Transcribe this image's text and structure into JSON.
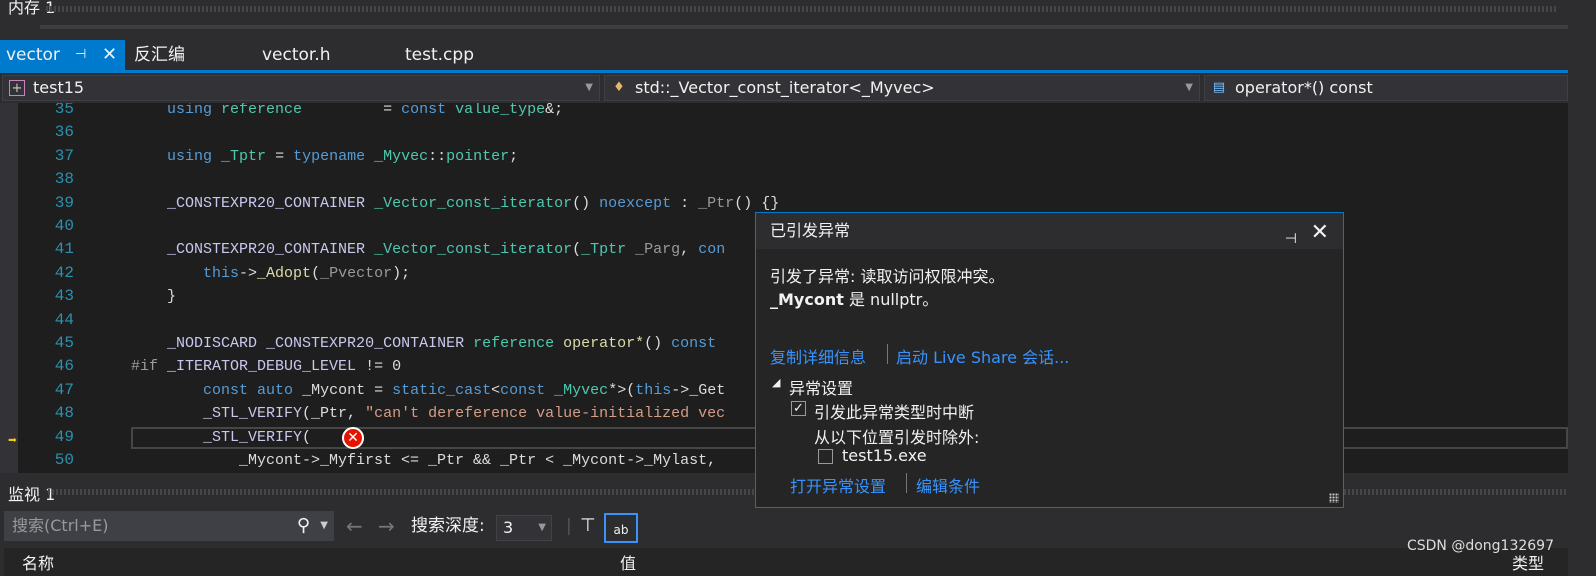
{
  "memory_panel": {
    "title": "内存 1"
  },
  "tabs": [
    {
      "label": "vector",
      "active": true
    },
    {
      "label": "反汇编"
    },
    {
      "label": "vector.h"
    },
    {
      "label": "test.cpp"
    }
  ],
  "navbar": {
    "project": "test15",
    "scope": "std::_Vector_const_iterator<_Myvec>",
    "member": "operator*() const"
  },
  "code_lines": [
    {
      "n": "35",
      "t": [
        [
          "    "
        ],
        [
          "using",
          "kw"
        ],
        [
          " "
        ],
        [
          "reference",
          "ty"
        ],
        [
          "         = "
        ],
        [
          "const",
          "kw"
        ],
        [
          " "
        ],
        [
          "value_type",
          "ty"
        ],
        [
          "&;"
        ]
      ]
    },
    {
      "n": "36",
      "t": []
    },
    {
      "n": "37",
      "t": [
        [
          "    "
        ],
        [
          "using",
          "kw"
        ],
        [
          " "
        ],
        [
          "_Tptr",
          "ty"
        ],
        [
          " = "
        ],
        [
          "typename",
          "kw"
        ],
        [
          " "
        ],
        [
          "_Myvec",
          "ty"
        ],
        [
          "::"
        ],
        [
          "pointer",
          "ty"
        ],
        [
          ";"
        ]
      ]
    },
    {
      "n": "38",
      "t": []
    },
    {
      "n": "39",
      "t": [
        [
          "    "
        ],
        [
          "_CONSTEXPR20_CONTAINER",
          "mac"
        ],
        [
          " "
        ],
        [
          "_Vector_const_iterator",
          "ty"
        ],
        [
          "() "
        ],
        [
          "noexcept",
          "kw"
        ],
        [
          " : "
        ],
        [
          "_Ptr",
          "par"
        ],
        [
          "() {}"
        ]
      ]
    },
    {
      "n": "40",
      "t": []
    },
    {
      "n": "41",
      "t": [
        [
          "    "
        ],
        [
          "_CONSTEXPR20_CONTAINER",
          "mac"
        ],
        [
          " "
        ],
        [
          "_Vector_const_iterator",
          "ty"
        ],
        [
          "("
        ],
        [
          "_Tptr",
          "ty"
        ],
        [
          " "
        ],
        [
          "_Parg",
          "par"
        ],
        [
          ", "
        ],
        [
          "con",
          "kw"
        ]
      ]
    },
    {
      "n": "42",
      "t": [
        [
          "        "
        ],
        [
          "this",
          "kw"
        ],
        [
          "->"
        ],
        [
          "_Adopt",
          "fn"
        ],
        [
          "("
        ],
        [
          "_Pvector",
          "par"
        ],
        [
          ");"
        ]
      ]
    },
    {
      "n": "43",
      "t": [
        [
          "    }"
        ]
      ]
    },
    {
      "n": "44",
      "t": []
    },
    {
      "n": "45",
      "t": [
        [
          "    "
        ],
        [
          "_NODISCARD",
          "mac"
        ],
        [
          " "
        ],
        [
          "_CONSTEXPR20_CONTAINER",
          "mac"
        ],
        [
          " "
        ],
        [
          "reference",
          "ty"
        ],
        [
          " "
        ],
        [
          "operator*",
          "fn"
        ],
        [
          "() "
        ],
        [
          "const",
          "kw"
        ]
      ]
    },
    {
      "n": "46",
      "t": [
        [
          "#if",
          "pp"
        ],
        [
          " "
        ],
        [
          "_ITERATOR_DEBUG_LEVEL",
          "mac"
        ],
        [
          " != 0"
        ]
      ]
    },
    {
      "n": "47",
      "t": [
        [
          "        "
        ],
        [
          "const",
          "kw"
        ],
        [
          " "
        ],
        [
          "auto",
          "kw"
        ],
        [
          " _Mycont = "
        ],
        [
          "static_cast",
          "kw"
        ],
        [
          "<"
        ],
        [
          "const",
          "kw"
        ],
        [
          " "
        ],
        [
          "_Myvec",
          "ty"
        ],
        [
          "*>("
        ],
        [
          "this",
          "kw"
        ],
        [
          "->_Get"
        ]
      ]
    },
    {
      "n": "48",
      "t": [
        [
          "        "
        ],
        [
          "_STL_VERIFY",
          "mac"
        ],
        [
          "(_Ptr, "
        ],
        [
          "\"can't dereference value-initialized vec",
          "str"
        ]
      ]
    },
    {
      "n": "49",
      "t": [
        [
          "        "
        ],
        [
          "_STL_VERIFY",
          "mac"
        ],
        [
          "("
        ]
      ],
      "current": true
    },
    {
      "n": "50",
      "t": [
        [
          "            _Mycont->_Myfirst <= _Ptr && _Ptr < _Mycont->_Mylast,"
        ]
      ]
    }
  ],
  "watch": {
    "title": "监视 1",
    "search_placeholder": "搜索(Ctrl+E)",
    "depth_label": "搜索深度:",
    "depth_value": "3",
    "columns": [
      "名称",
      "值",
      "类型"
    ]
  },
  "exception_popup": {
    "title": "已引发异常",
    "message": "引发了异常: 读取访问权限冲突。",
    "detail_var": "_Mycont",
    "detail_rest": " 是 nullptr。",
    "link_copy": "复制详细信息",
    "link_liveshare": "启动 Live Share 会话...",
    "settings_header": "异常设置",
    "break_label": "引发此异常类型时中断",
    "break_checked": true,
    "except_label": "从以下位置引发时除外:",
    "exe_label": "test15.exe",
    "exe_checked": false,
    "link_open": "打开异常设置",
    "link_edit": "编辑条件"
  },
  "watermark": "CSDN @dong132697",
  "colors": {
    "accent": "#007acc",
    "link": "#3794ff",
    "error": "#e51400"
  }
}
